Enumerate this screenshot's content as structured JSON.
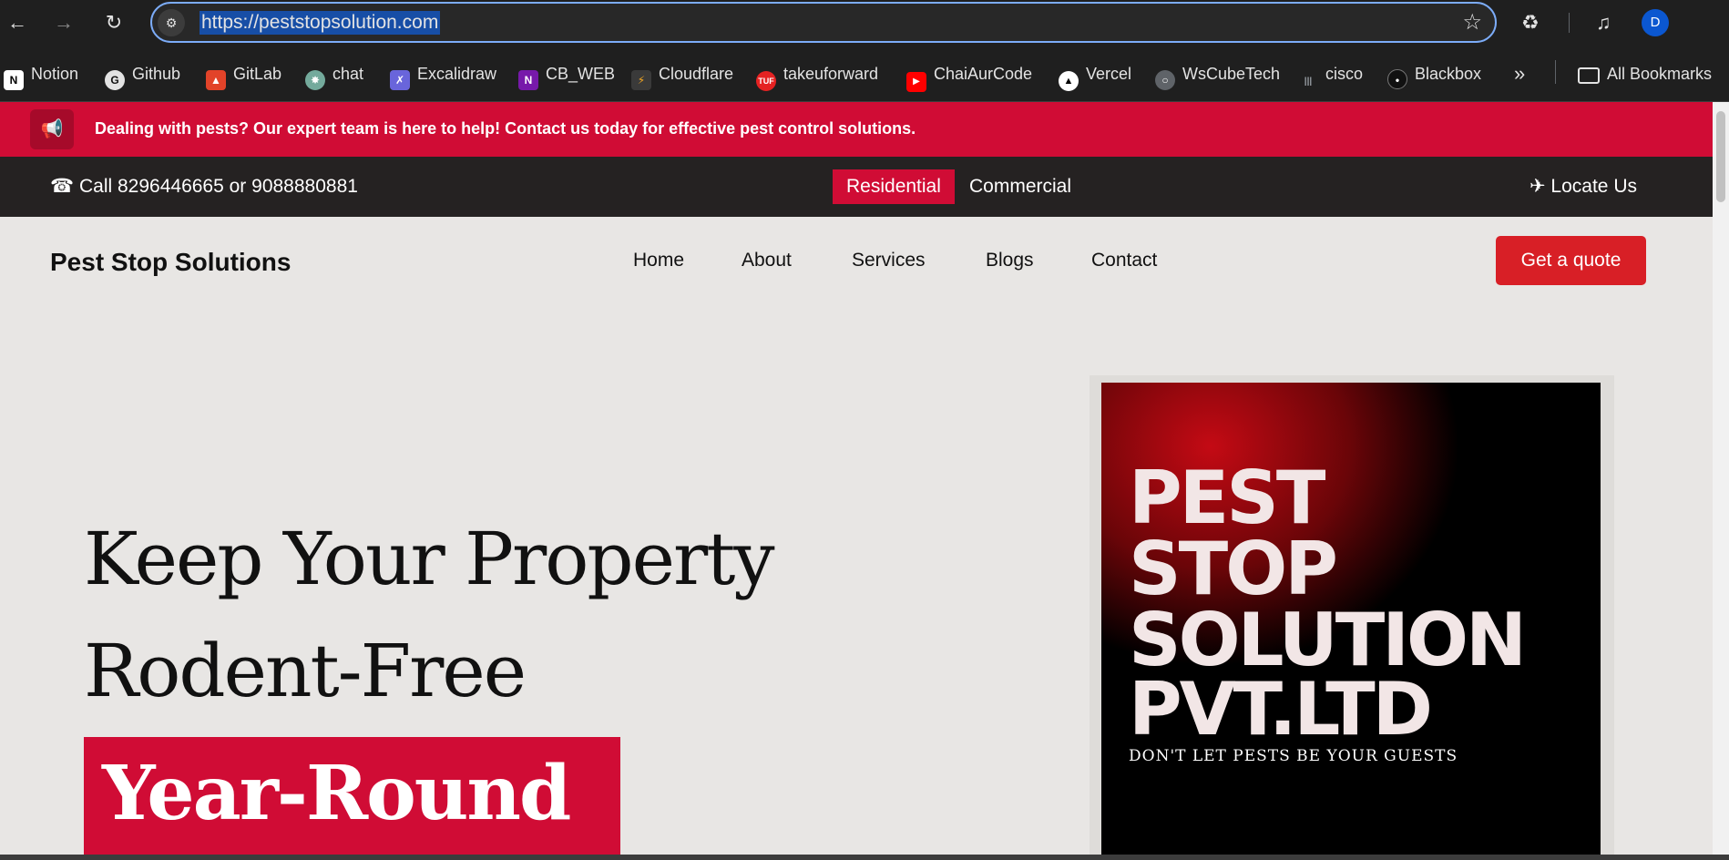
{
  "browser": {
    "url": "https://peststopsolution.com",
    "profile_initial": "D",
    "bookmarks": [
      {
        "label": "Notion",
        "icon": "notion-icon"
      },
      {
        "label": "Github",
        "icon": "github-icon"
      },
      {
        "label": "GitLab",
        "icon": "gitlab-icon"
      },
      {
        "label": "chat",
        "icon": "chatgpt-icon"
      },
      {
        "label": "Excalidraw",
        "icon": "excalidraw-icon"
      },
      {
        "label": "CB_WEB",
        "icon": "onenote-icon"
      },
      {
        "label": "Cloudflare",
        "icon": "cloudflare-icon"
      },
      {
        "label": "takeuforward",
        "icon": "tuf-icon"
      },
      {
        "label": "ChaiAurCode",
        "icon": "youtube-icon"
      },
      {
        "label": "Vercel",
        "icon": "vercel-icon"
      },
      {
        "label": "WsCubeTech",
        "icon": "globe-icon"
      },
      {
        "label": "cisco",
        "icon": "cisco-icon"
      },
      {
        "label": "Blackbox",
        "icon": "blackbox-icon"
      }
    ],
    "all_bookmarks_label": "All Bookmarks"
  },
  "announcement": {
    "text": "Dealing with pests? Our expert team is here to help! Contact us today for effective pest control solutions."
  },
  "topbar": {
    "call_text": "☎ Call 8296446665 or 9088880881",
    "residential_label": "Residential",
    "commercial_label": "Commercial",
    "locate_label": "✈ Locate Us"
  },
  "header": {
    "brand": "Pest Stop Solutions",
    "nav": [
      "Home",
      "About",
      "Services",
      "Blogs",
      "Contact"
    ],
    "quote_button": "Get a quote"
  },
  "hero": {
    "line1": "Keep Your Property",
    "line2": "Rodent-Free",
    "highlight": "Year-Round"
  },
  "poster": {
    "lines": [
      "PEST",
      "STOP",
      "SOLUTION",
      "PVT.LTD"
    ],
    "tagline": "DON'T LET PESTS BE YOUR GUESTS"
  },
  "colors": {
    "accent_red": "#d00c35",
    "quote_red": "#d81f26",
    "topbar_dark": "#252222",
    "page_bg": "#e8e6e4"
  }
}
